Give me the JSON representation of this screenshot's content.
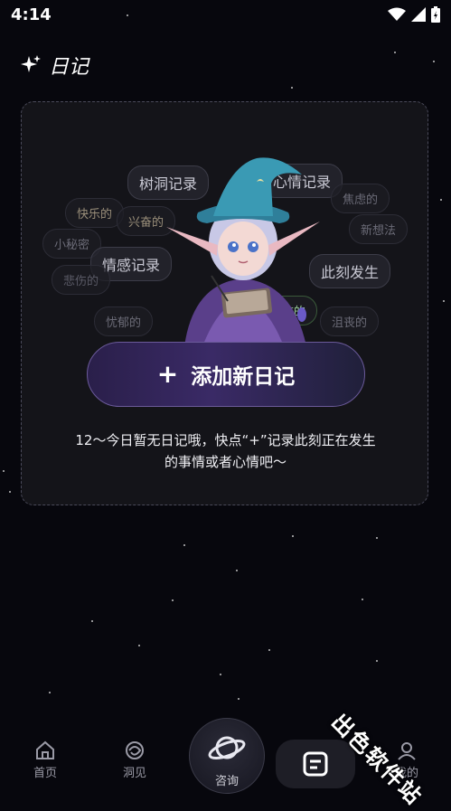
{
  "status_bar": {
    "time": "4:14"
  },
  "header": {
    "title": "日记"
  },
  "card": {
    "bubbles": [
      "树洞记录",
      "心情记录",
      "焦虑的",
      "快乐的",
      "兴奋的",
      "新想法",
      "小秘密",
      "情感记录",
      "此刻发生",
      "悲伤的",
      "忧郁的",
      "自信的",
      "沮丧的"
    ],
    "add_button_label": "添加新日记",
    "empty_message_line1": "12～今日暂无日记哦，快点“+”记录此刻正在发生",
    "empty_message_line2": "的事情或者心情吧～"
  },
  "tabbar": {
    "home": "首页",
    "insight": "洞见",
    "consult": "咨询",
    "mine": "我的"
  },
  "watermark": "出色软件站"
}
